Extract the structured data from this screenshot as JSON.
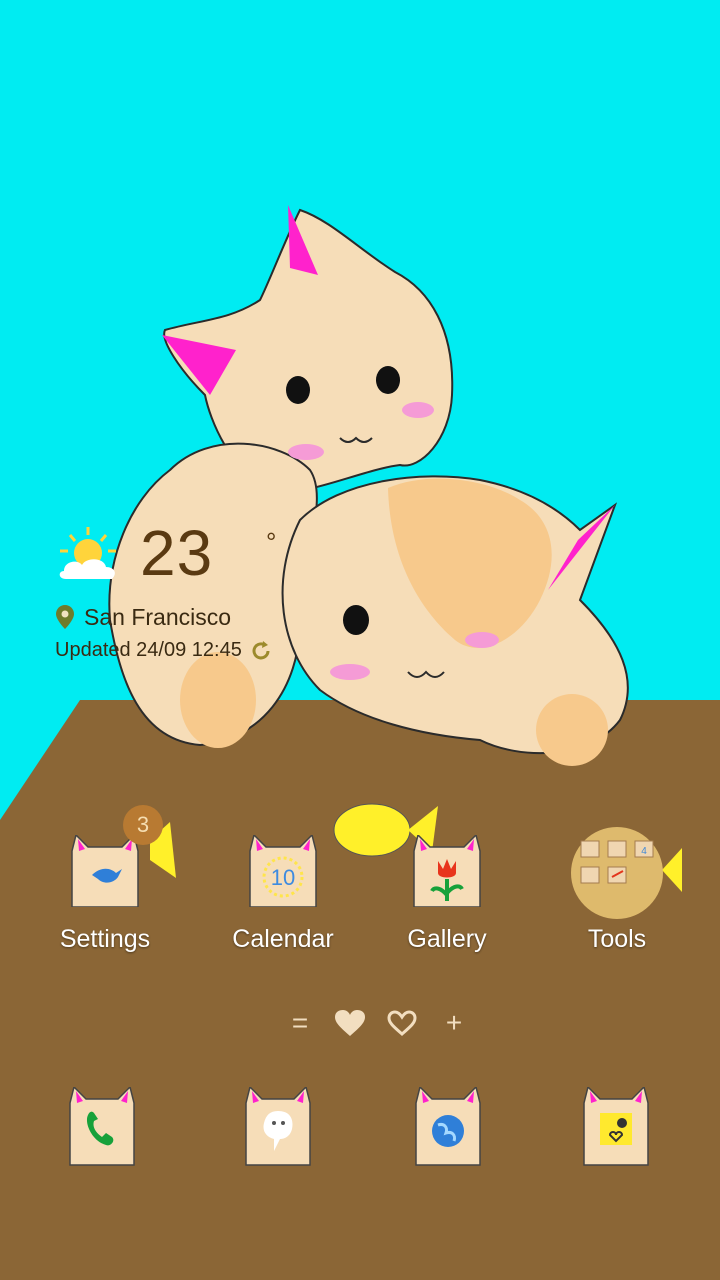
{
  "theme": {
    "sky_color": "#00ECF2",
    "ground_color": "#8B6636",
    "cat_color": "#F6DDB8",
    "ear_color": "#FF22CC",
    "label_color": "#FFFFFF"
  },
  "weather": {
    "icon": "partly-sunny-icon",
    "temperature": "23",
    "unit": "°",
    "location": "San Francisco",
    "location_icon": "location-pin-icon",
    "updated": "Updated 24/09 12:45",
    "refresh_icon": "refresh-icon"
  },
  "apps": [
    {
      "label": "Settings",
      "icon": "settings-bird-icon",
      "badge": "3"
    },
    {
      "label": "Calendar",
      "icon": "calendar-icon",
      "day": "10"
    },
    {
      "label": "Gallery",
      "icon": "gallery-tulip-icon"
    },
    {
      "label": "Tools",
      "icon": "tools-folder-icon",
      "folder_previews": [
        "",
        "",
        "4",
        "",
        "",
        ""
      ]
    }
  ],
  "page_indicator": {
    "left": "=",
    "right": "+",
    "icons": [
      "filled-heart-icon",
      "outline-heart-icon"
    ]
  },
  "dock": [
    {
      "icon": "phone-icon"
    },
    {
      "icon": "messages-icon"
    },
    {
      "icon": "browser-globe-icon"
    },
    {
      "icon": "camera-icon"
    }
  ]
}
